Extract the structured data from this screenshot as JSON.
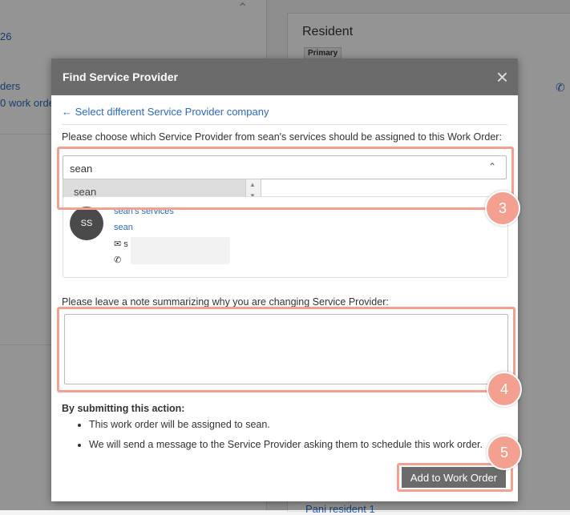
{
  "background": {
    "left_text_1": "26",
    "left_text_2": "ders",
    "left_text_3": "0 work orde",
    "resident_title": "Resident",
    "primary_badge": "Primary",
    "resident_link": "Pani resident 1"
  },
  "modal": {
    "title": "Find Service Provider",
    "back_link": "Select different Service Provider company",
    "choose_text": "Please choose which Service Provider from sean's services should be assigned to this Work Order:",
    "select_value": "sean",
    "dropdown_option": "sean",
    "provider": {
      "initials": "SS",
      "company": "sean's services",
      "name": "sean",
      "email_prefix": "s"
    },
    "note_label": "Please leave a note summarizing why you are changing Service Provider:",
    "submit_title": "By submitting this action:",
    "bullets": [
      "This work order will be assigned to sean.",
      "We will send a message to the Service Provider asking them to schedule this work order."
    ],
    "submit_button": "Add to Work Order"
  },
  "annotations": {
    "step_3": "3",
    "step_4": "4",
    "step_5": "5",
    "color": "#f4a090"
  }
}
